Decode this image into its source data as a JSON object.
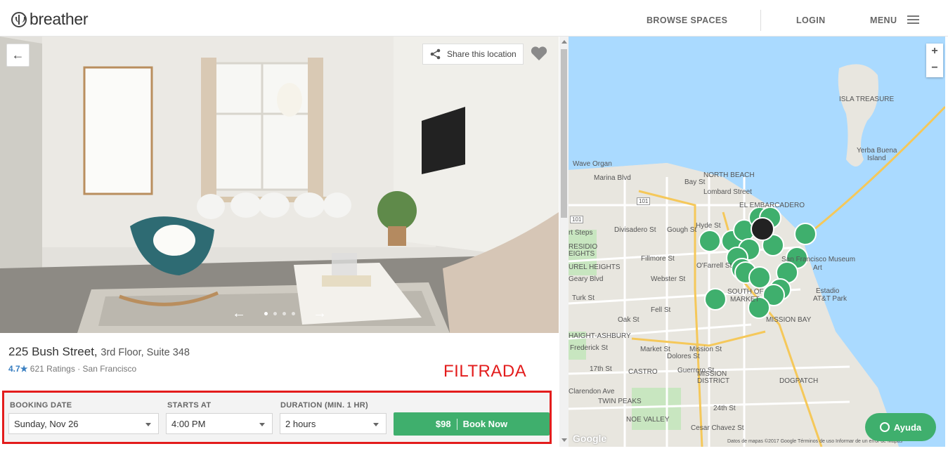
{
  "header": {
    "logo_text": "breather",
    "browse": "BROWSE SPACES",
    "login": "LOGIN",
    "menu": "MENU"
  },
  "photo": {
    "back_icon": "←",
    "share_label": "Share this location",
    "prev_icon": "←",
    "next_icon": "→"
  },
  "listing": {
    "address": "225 Bush Street,",
    "suite": "3rd Floor, Suite 348",
    "rating": "4.7",
    "star": "★",
    "ratings_count": "621 Ratings",
    "separator": "·",
    "city": "San Francisco"
  },
  "annotation": "FILTRADA",
  "booking": {
    "date_label": "BOOKING DATE",
    "date_value": "Sunday, Nov 26",
    "start_label": "STARTS AT",
    "start_value": "4:00 PM",
    "duration_label": "DURATION (MIN. 1 HR)",
    "duration_value": "2 hours",
    "price": "$98",
    "book_label": "Book Now"
  },
  "map": {
    "zoom_in": "+",
    "zoom_out": "−",
    "labels": {
      "isla_treasure": "ISLA TREASURE",
      "yerba_buena_1": "Yerba Buena",
      "yerba_buena_2": "Island",
      "wave_organ": "Wave Organ",
      "marina": "Marina Blvd",
      "north_beach": "NORTH BEACH",
      "bay_st": "Bay St",
      "lombard": "Lombard Street",
      "embarcadero": "EL EMBARCADERO",
      "steps": "rt Steps",
      "presidio_1": "RESIDIO",
      "presidio_2": "EIGHTS",
      "laurel": "UREL HEIGHTS",
      "fillmore": "Fillmore St",
      "divisadero": "Divisadero St",
      "gough": "Gough St",
      "hyde": "Hyde St",
      "ofarrell": "O'Farrell St",
      "geary": "Geary Blvd",
      "turk": "Turk St",
      "fell": "Fell St",
      "oak": "Oak St",
      "webster": "Webster St",
      "haight": "HAIGHT-ASHBURY",
      "frederick": "Frederick St",
      "market": "Market St",
      "castro": "CASTRO",
      "sfmoma_1": "San Francisco Museum",
      "sfmoma_2": "Art",
      "estadio_1": "Estadio",
      "estadio_2": "AT&T Park",
      "south_1": "SOUTH OF",
      "south_2": "MARKET",
      "mission_bay": "MISSION BAY",
      "mission_1": "MISSION",
      "mission_2": "DISTRICT",
      "dolores": "Dolores St",
      "guerrero": "Guerrero St",
      "mission_st": "Mission St",
      "dogpatch": "DOGPATCH",
      "twin_peaks": "TWIN PEAKS",
      "st17": "17th St",
      "st24": "24th St",
      "noe": "NOE VALLEY",
      "cesar": "Cesar Chavez St",
      "clarendon": "Clarendon Ave",
      "hwy101a": "101",
      "hwy101b": "101"
    },
    "google": "Google",
    "footer": "Datos de mapas ©2017 Google   Términos de uso   Informar de un error de Mapas"
  },
  "help": {
    "label": "Ayuda"
  },
  "colors": {
    "accent_green": "#3faf6d",
    "annotation_red": "#e31c1c",
    "rating_blue": "#3a7fc1",
    "map_water": "#aadaff"
  }
}
